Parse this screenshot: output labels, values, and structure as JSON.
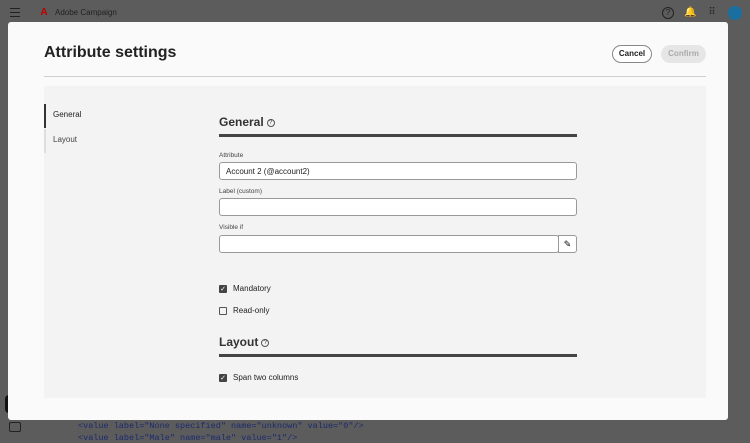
{
  "app": {
    "name": "Adobe Campaign"
  },
  "background_code": [
    "<value label=\"None specified\" name=\"unknown\" value=\"0\"/>",
    "<value label=\"Male\" name=\"male\" value=\"1\"/>"
  ],
  "dialog": {
    "title": "Attribute settings",
    "cancel_label": "Cancel",
    "confirm_label": "Confirm",
    "nav": [
      {
        "label": "General",
        "active": true
      },
      {
        "label": "Layout",
        "active": false
      }
    ],
    "general": {
      "heading": "General",
      "attribute_label": "Attribute",
      "attribute_value": "Account 2 (@account2)",
      "label_custom_label": "Label (custom)",
      "label_custom_value": "",
      "visible_if_label": "Visible if",
      "visible_if_value": "",
      "mandatory_label": "Mandatory",
      "mandatory_checked": true,
      "readonly_label": "Read-only",
      "readonly_checked": false
    },
    "layout": {
      "heading": "Layout",
      "span_label": "Span two columns",
      "span_checked": true
    }
  }
}
